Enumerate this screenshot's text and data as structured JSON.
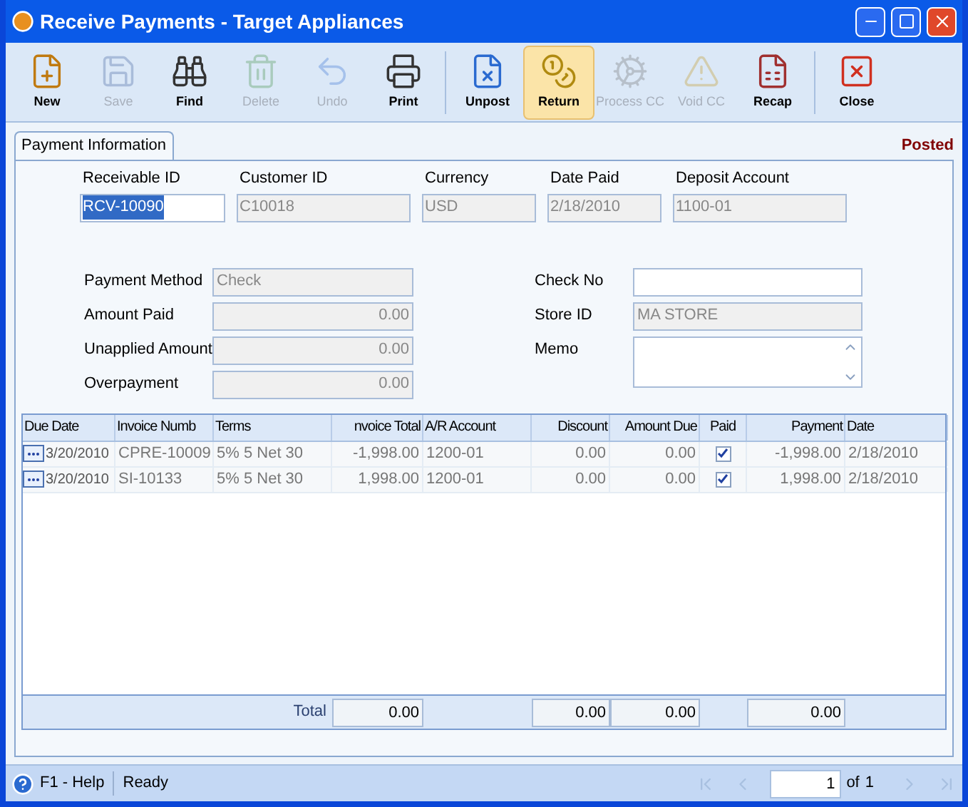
{
  "window": {
    "title": "Receive Payments - Target Appliances"
  },
  "toolbar": [
    [
      {
        "label": "New",
        "disabled": false,
        "selected": false
      },
      {
        "label": "Save",
        "disabled": true,
        "selected": false
      },
      {
        "label": "Find",
        "disabled": false,
        "selected": false
      },
      {
        "label": "Delete",
        "disabled": true,
        "selected": false
      },
      {
        "label": "Undo",
        "disabled": true,
        "selected": false
      },
      {
        "label": "Print",
        "disabled": false,
        "selected": false
      }
    ],
    [
      {
        "label": "Unpost",
        "disabled": false,
        "selected": false
      },
      {
        "label": "Return",
        "disabled": false,
        "selected": true
      },
      {
        "label": "Process CC",
        "disabled": true,
        "selected": false
      },
      {
        "label": "Void CC",
        "disabled": true,
        "selected": false
      },
      {
        "label": "Recap",
        "disabled": false,
        "selected": false
      }
    ],
    [
      {
        "label": "Close",
        "disabled": false,
        "selected": false
      }
    ]
  ],
  "tabs": [
    {
      "label": "Payment Information",
      "selected": true
    }
  ],
  "status": "Posted",
  "header_fields": [
    {
      "label": "Receivable ID",
      "value": "RCV-10090",
      "disabled": false,
      "text_selected": true
    },
    {
      "label": "Customer ID",
      "value": "C10018",
      "disabled": true,
      "text_selected": false
    },
    {
      "label": "Currency",
      "value": "USD",
      "disabled": true,
      "text_selected": false
    },
    {
      "label": "Date Paid",
      "value": "2/18/2010",
      "disabled": true,
      "text_selected": false
    },
    {
      "label": "Deposit Account",
      "value": "1100-01",
      "disabled": true,
      "text_selected": false
    }
  ],
  "left_fields": [
    {
      "label": "Payment Method",
      "value": "Check"
    },
    {
      "label": "Amount Paid",
      "value": "0.00"
    },
    {
      "label": "Unapplied Amount",
      "value": "0.00"
    },
    {
      "label": "Overpayment",
      "value": "0.00"
    }
  ],
  "right_fields": [
    {
      "label": "Check No",
      "kind": "text",
      "disabled": false
    },
    {
      "label": "Store ID",
      "value": "MA STORE",
      "kind": "text",
      "disabled": true
    },
    {
      "label": "Memo",
      "kind": "memo",
      "disabled": false
    }
  ],
  "table": {
    "columns": [
      "Due Date",
      "Invoice Numb",
      "Terms",
      "nvoice Total",
      "A/R Account",
      "Discount",
      "Amount Due",
      "Paid",
      "Payment",
      "Date"
    ],
    "rows": [
      {
        "due_date": "3/20/2010",
        "invoice": "CPRE-10009",
        "terms": "5% 5 Net 30",
        "invoice_total": "-1,998.00",
        "ar_account": "1200-01",
        "discount": "0.00",
        "amount_due": "0.00",
        "paid": true,
        "payment": "-1,998.00",
        "date": "2/18/2010"
      },
      {
        "due_date": "3/20/2010",
        "invoice": "SI-10133",
        "terms": "5% 5 Net 30",
        "invoice_total": "1,998.00",
        "ar_account": "1200-01",
        "discount": "0.00",
        "amount_due": "0.00",
        "paid": true,
        "payment": "1,998.00",
        "date": "2/18/2010"
      }
    ],
    "totals": {
      "label": "Total",
      "invoice_total": "0.00",
      "discount": "0.00",
      "amount_due": "0.00",
      "payment": "0.00"
    }
  },
  "status_bar": {
    "help": "F1 - Help",
    "message": "Ready",
    "page": "1",
    "of": "of",
    "pages": "1"
  }
}
